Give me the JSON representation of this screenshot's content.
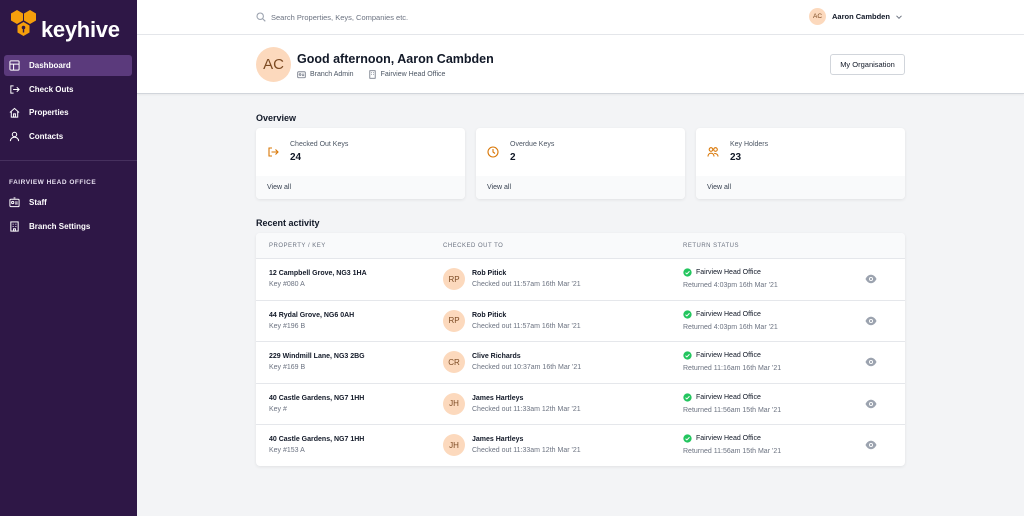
{
  "brand": {
    "name": "keyhive",
    "accent": "#f59e0b",
    "sidebar_bg": "#2e1746"
  },
  "sidebar": {
    "items": [
      {
        "label": "Dashboard",
        "icon": "dashboard-icon",
        "active": true
      },
      {
        "label": "Check Outs",
        "icon": "check-out-icon"
      },
      {
        "label": "Properties",
        "icon": "home-icon"
      },
      {
        "label": "Contacts",
        "icon": "contacts-icon"
      }
    ],
    "section_title": "FAIRVIEW HEAD OFFICE",
    "section_items": [
      {
        "label": "Staff",
        "icon": "id-card-icon"
      },
      {
        "label": "Branch Settings",
        "icon": "building-icon"
      }
    ]
  },
  "topbar": {
    "search_placeholder": "Search Properties, Keys, Companies etc.",
    "user_initials": "AC",
    "user_name": "Aaron Cambden"
  },
  "header": {
    "initials": "AC",
    "greeting": "Good afternoon, Aaron Cambden",
    "role": "Branch Admin",
    "office": "Fairview Head Office",
    "org_button": "My Organisation"
  },
  "overview": {
    "title": "Overview",
    "cards": [
      {
        "label": "Checked Out Keys",
        "value": "24",
        "link": "View all",
        "icon": "check-out-icon"
      },
      {
        "label": "Overdue Keys",
        "value": "2",
        "link": "View all",
        "icon": "clock-icon"
      },
      {
        "label": "Key Holders",
        "value": "23",
        "link": "View all",
        "icon": "key-holders-icon"
      }
    ]
  },
  "activity": {
    "title": "Recent activity",
    "columns": [
      "PROPERTY / KEY",
      "CHECKED OUT TO",
      "RETURN STATUS"
    ],
    "status_color": "#22c55e",
    "rows": [
      {
        "property": "12 Campbell Grove, NG3 1HA",
        "key": "Key #080 A",
        "initials": "RP",
        "holder": "Rob Pitick",
        "checked_out": "Checked out 11:57am 16th Mar '21",
        "status": "Fairview Head Office",
        "returned": "Returned 4:03pm 16th Mar '21"
      },
      {
        "property": "44 Rydal Grove, NG6 0AH",
        "key": "Key #196 B",
        "initials": "RP",
        "holder": "Rob Pitick",
        "checked_out": "Checked out 11:57am 16th Mar '21",
        "status": "Fairview Head Office",
        "returned": "Returned 4:03pm 16th Mar '21"
      },
      {
        "property": "229 Windmill Lane, NG3 2BG",
        "key": "Key #169 B",
        "initials": "CR",
        "holder": "Clive Richards",
        "checked_out": "Checked out 10:37am 16th Mar '21",
        "status": "Fairview Head Office",
        "returned": "Returned 11:16am 16th Mar '21"
      },
      {
        "property": "40 Castle Gardens, NG7 1HH",
        "key": "Key #",
        "initials": "JH",
        "holder": "James Hartleys",
        "checked_out": "Checked out 11:33am 12th Mar '21",
        "status": "Fairview Head Office",
        "returned": "Returned 11:56am 15th Mar '21"
      },
      {
        "property": "40 Castle Gardens, NG7 1HH",
        "key": "Key #153 A",
        "initials": "JH",
        "holder": "James Hartleys",
        "checked_out": "Checked out 11:33am 12th Mar '21",
        "status": "Fairview Head Office",
        "returned": "Returned 11:56am 15th Mar '21"
      }
    ]
  }
}
